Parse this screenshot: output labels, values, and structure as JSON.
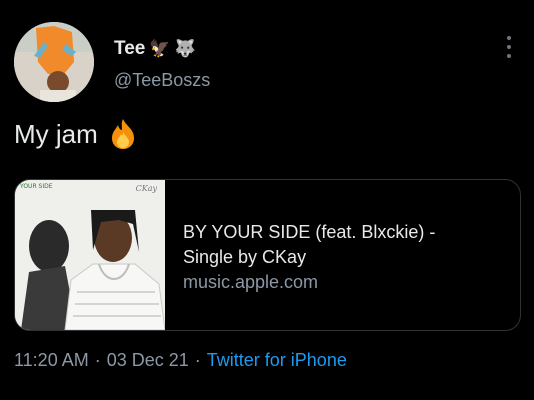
{
  "tweet": {
    "author_name": "Tee",
    "name_emojis": [
      "🦅",
      "🐺"
    ],
    "handle": "@TeeBoszs",
    "text": "My jam",
    "text_emoji": "fire-icon",
    "card": {
      "title": "BY YOUR SIDE (feat. Blxckie) - Single by CKay",
      "domain": "music.apple.com",
      "art_label_left": "YOUR SIDE",
      "art_label_right": "CKay"
    },
    "time": "11:20 AM",
    "separator": "·",
    "date": "03 Dec 21",
    "source": "Twitter for iPhone"
  },
  "colors": {
    "background": "#000000",
    "text_primary": "#e7e9ea",
    "text_secondary": "#8b98a5",
    "link": "#1d9bf0",
    "card_border": "#2f3336"
  }
}
